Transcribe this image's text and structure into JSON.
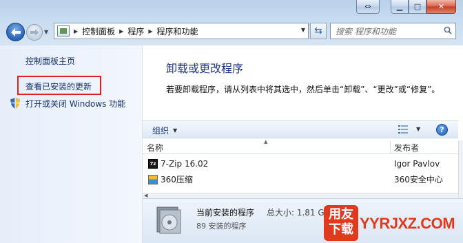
{
  "window": {
    "caption_buttons": [
      "swap-icon",
      "minimize-icon",
      "maximize-icon",
      "close-icon"
    ]
  },
  "address_bar": {
    "breadcrumbs": [
      "控制面板",
      "程序",
      "程序和功能"
    ]
  },
  "search": {
    "placeholder": "搜索 程序和功能"
  },
  "left_pane": {
    "links": [
      {
        "label": "控制面板主页"
      },
      {
        "label": "查看已安装的更新"
      },
      {
        "label": "打开或关闭 Windows 功能"
      }
    ]
  },
  "main": {
    "title": "卸载或更改程序",
    "description": "若要卸载程序，请从列表中将其选中，然后单击“卸载”、“更改”或“修复”。"
  },
  "toolbar": {
    "organize_label": "组织"
  },
  "table": {
    "columns": [
      "名称",
      "发布者"
    ],
    "rows": [
      {
        "name": "7-Zip 16.02",
        "publisher": "Igor Pavlov",
        "icon": "7zip-icon"
      },
      {
        "name": "360压缩",
        "publisher": "360安全中心",
        "icon": "360zip-icon"
      }
    ]
  },
  "details": {
    "summary_label": "当前安装的程序",
    "size_label": "总大小: 1.81 GB",
    "count_label": "89 安装的程序"
  },
  "watermark": {
    "badge_text": "用友下载",
    "site_text": "YYRJXZ.COM"
  },
  "colors": {
    "link": "#15316d",
    "title": "#1e3287",
    "highlight_box": "#e02020",
    "watermark": "#e03a1e"
  }
}
